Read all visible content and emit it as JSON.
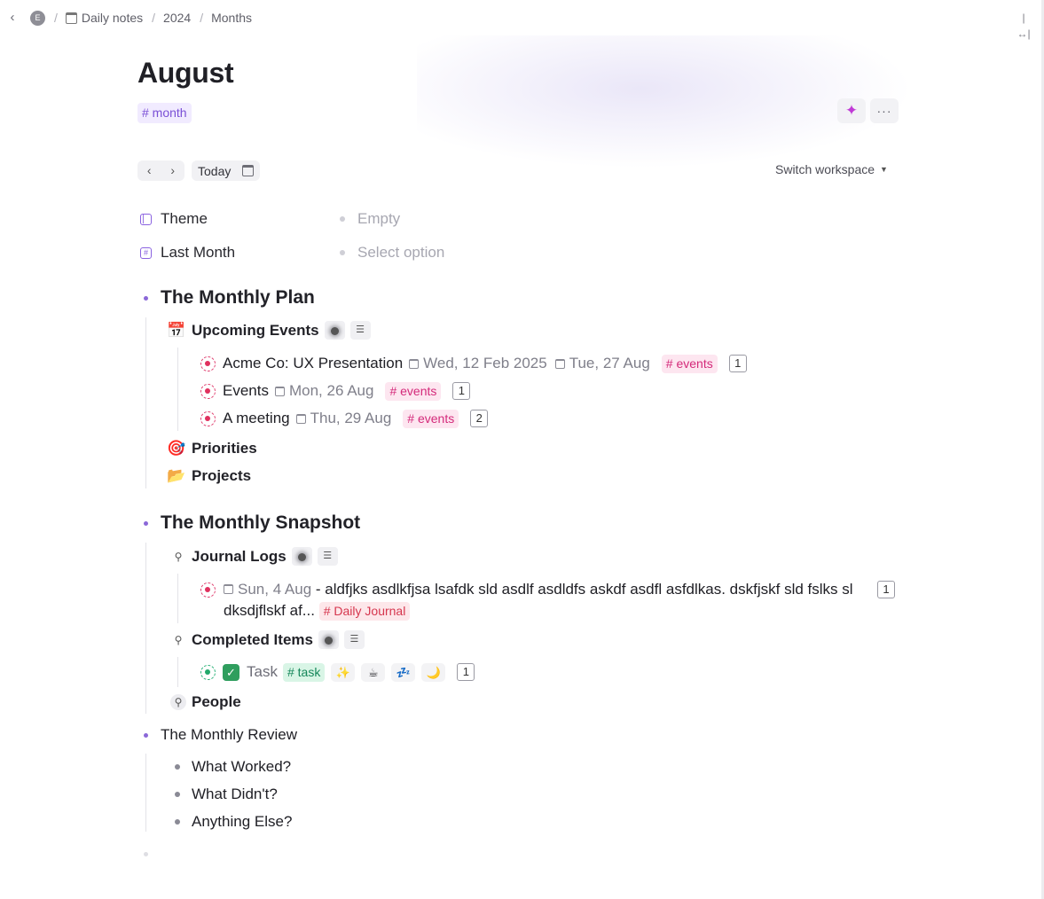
{
  "breadcrumb": {
    "workspace_initial": "E",
    "items": [
      "Daily notes",
      "2024",
      "Months"
    ]
  },
  "page": {
    "title": "August",
    "tag": "# month"
  },
  "nav": {
    "today_label": "Today",
    "switch_workspace_label": "Switch workspace"
  },
  "properties": [
    {
      "label": "Theme",
      "value": "Empty"
    },
    {
      "label": "Last Month",
      "value": "Select option"
    }
  ],
  "outline": {
    "monthly_plan": {
      "title": "The Monthly Plan",
      "upcoming_events": {
        "title": "Upcoming Events",
        "items": [
          {
            "title": "Acme Co: UX Presentation",
            "date1": "Wed, 12 Feb 2025",
            "date2": "Tue, 27 Aug",
            "tag": "# events",
            "count": "1"
          },
          {
            "title": "Events",
            "date1": "Mon, 26 Aug",
            "tag": "# events",
            "count": "1"
          },
          {
            "title": "A meeting",
            "date1": "Thu, 29 Aug",
            "tag": "# events",
            "count": "2"
          }
        ]
      },
      "priorities": "Priorities",
      "projects": "Projects"
    },
    "monthly_snapshot": {
      "title": "The Monthly Snapshot",
      "journal_logs": {
        "title": "Journal Logs",
        "entry": {
          "date": "Sun, 4 Aug",
          "text": " - aldfjks asdlkfjsa lsafdk sld asdlf asdldfs askdf asdfl asfdlkas. dskfjskf sld fslks sl dksdjflskf af...",
          "tag": "# Daily Journal",
          "count": "1"
        }
      },
      "completed_items": {
        "title": "Completed Items",
        "task": {
          "label": "Task",
          "tag": "# task",
          "emojis": [
            "✨",
            "☕",
            "💤",
            "🌙"
          ],
          "count": "1"
        }
      },
      "people": "People"
    },
    "monthly_review": {
      "title": "The Monthly Review",
      "items": [
        "What Worked?",
        "What Didn't?",
        "Anything Else?"
      ]
    }
  },
  "icons": {
    "back": "chevron-left-icon",
    "sidebar_toggle": "collapse-sidebar-icon",
    "calendar": "calendar-icon",
    "sparkle": "sparkle-icon",
    "more": "more-icon"
  },
  "colors": {
    "accent": "#8b68d8",
    "events_tag": "#d42a7a",
    "task_tag": "#15875a",
    "check": "#2f9e5e"
  }
}
